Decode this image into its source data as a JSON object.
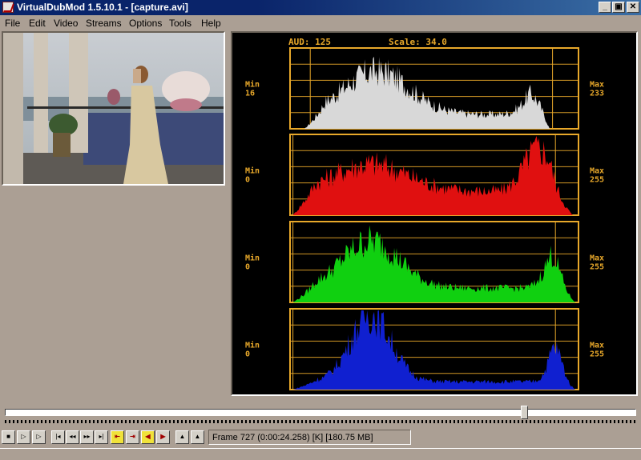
{
  "window": {
    "title": "VirtualDubMod 1.5.10.1 - [capture.avi]",
    "controls": {
      "minimize": "_",
      "restore": "▣",
      "close": "✕"
    }
  },
  "menu": [
    "File",
    "Edit",
    "Video",
    "Streams",
    "Options",
    "Tools",
    "Help"
  ],
  "histogram": {
    "header_aud": "AUD: 125",
    "header_scale": "Scale: 34.0",
    "axis_color": "#e8a82a",
    "channels": [
      {
        "name": "luma",
        "color": "#d8d8d8",
        "min_label": "Min",
        "min_value": "16",
        "max_label": "Max",
        "max_value": "233"
      },
      {
        "name": "red",
        "color": "#e01010",
        "min_label": "Min",
        "min_value": "0",
        "max_label": "Max",
        "max_value": "255"
      },
      {
        "name": "green",
        "color": "#10d010",
        "min_label": "Min",
        "min_value": "0",
        "max_label": "Max",
        "max_value": "255"
      },
      {
        "name": "blue",
        "color": "#1020d0",
        "min_label": "Min",
        "min_value": "0",
        "max_label": "Max",
        "max_value": "255"
      }
    ]
  },
  "position": {
    "fraction": 0.822
  },
  "toolbar": {
    "buttons": [
      {
        "name": "stop-button",
        "glyph": "■"
      },
      {
        "name": "play-input-button",
        "glyph": "▷"
      },
      {
        "name": "play-output-button",
        "glyph": "▷"
      },
      {
        "name": "go-start-button",
        "glyph": "|◂"
      },
      {
        "name": "step-back-button",
        "glyph": "◂◂"
      },
      {
        "name": "step-forward-button",
        "glyph": "▸▸"
      },
      {
        "name": "go-end-button",
        "glyph": "▸|"
      },
      {
        "name": "prev-keyframe-button",
        "glyph": "⇤"
      },
      {
        "name": "next-keyframe-button",
        "glyph": "⇥"
      },
      {
        "name": "scene-back-button",
        "glyph": "◀"
      },
      {
        "name": "scene-forward-button",
        "glyph": "▶"
      },
      {
        "name": "mark-in-button",
        "glyph": "▲"
      },
      {
        "name": "mark-out-button",
        "glyph": "▲"
      }
    ]
  },
  "status": {
    "frame_info": "Frame 727 (0:00:24.258) [K] [180.75 MB]"
  }
}
